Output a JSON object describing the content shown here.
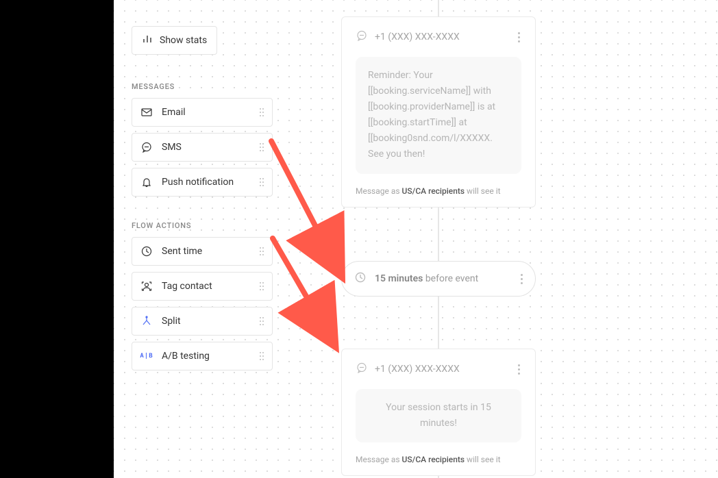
{
  "show_stats_label": "Show stats",
  "sections": {
    "messages": {
      "label": "MESSAGES",
      "items": [
        {
          "id": "email",
          "label": "Email"
        },
        {
          "id": "sms",
          "label": "SMS"
        },
        {
          "id": "push",
          "label": "Push notification"
        }
      ]
    },
    "flow_actions": {
      "label": "FLOW ACTIONS",
      "items": [
        {
          "id": "sent-time",
          "label": "Sent time"
        },
        {
          "id": "tag-contact",
          "label": "Tag contact"
        },
        {
          "id": "split",
          "label": "Split"
        },
        {
          "id": "ab-testing",
          "label": "A/B testing"
        }
      ]
    }
  },
  "nodes": {
    "sms1": {
      "phone": "+1 (XXX) XXX-XXXX",
      "body": "Reminder: Your [[booking.serviceName]] with [[booking.providerName]] is at [[booking.startTime]] at [[booking0snd.com/l/XXXXX. See you then!",
      "caption_prefix": "Message as ",
      "caption_strong": "US/CA recipients",
      "caption_suffix": " will see it"
    },
    "timer": {
      "bold": "15 minutes",
      "rest": " before event"
    },
    "sms2": {
      "phone": "+1 (XXX) XXX-XXXX",
      "body": "Your session starts in 15 minutes!",
      "caption_prefix": "Message as ",
      "caption_strong": "US/CA recipients",
      "caption_suffix": " will see it"
    }
  }
}
